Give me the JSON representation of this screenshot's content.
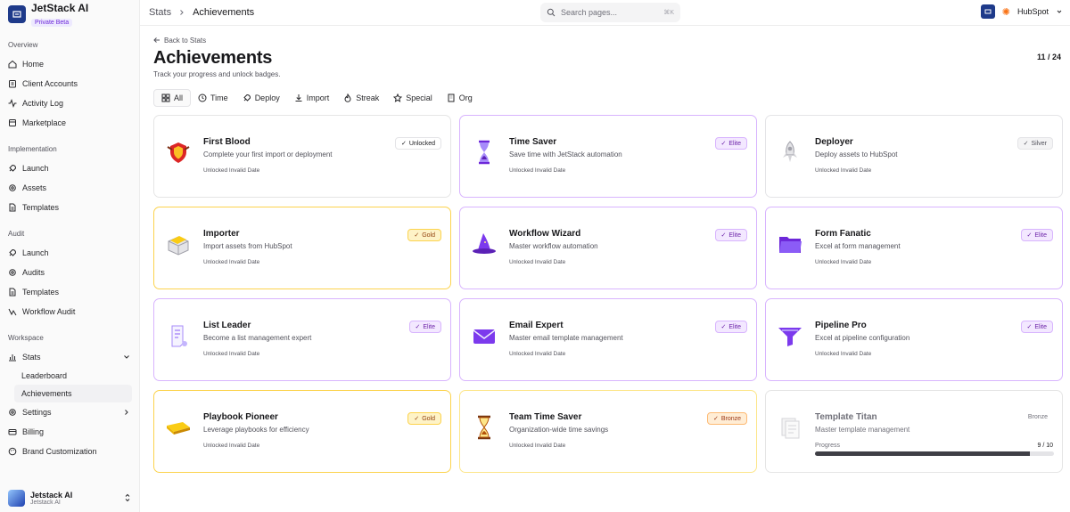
{
  "brand": {
    "name": "JetStack AI",
    "badge": "Private Beta"
  },
  "sidebar": {
    "overview_title": "Overview",
    "overview": [
      {
        "label": "Home",
        "icon": "home-icon"
      },
      {
        "label": "Client Accounts",
        "icon": "clipboard-icon"
      },
      {
        "label": "Activity Log",
        "icon": "activity-icon"
      },
      {
        "label": "Marketplace",
        "icon": "store-icon"
      }
    ],
    "implementation_title": "Implementation",
    "implementation": [
      {
        "label": "Launch",
        "icon": "rocket-icon"
      },
      {
        "label": "Assets",
        "icon": "gear-icon"
      },
      {
        "label": "Templates",
        "icon": "file-icon"
      }
    ],
    "audit_title": "Audit",
    "audit": [
      {
        "label": "Launch",
        "icon": "rocket-icon"
      },
      {
        "label": "Audits",
        "icon": "gear-icon"
      },
      {
        "label": "Templates",
        "icon": "file-icon"
      },
      {
        "label": "Workflow Audit",
        "icon": "workflow-icon"
      }
    ],
    "workspace_title": "Workspace",
    "stats_label": "Stats",
    "stats_sub": [
      "Leaderboard",
      "Achievements"
    ],
    "settings_label": "Settings",
    "billing_label": "Billing",
    "brand_label": "Brand Customization"
  },
  "user": {
    "name": "Jetstack AI",
    "org": "Jetstack AI"
  },
  "topbar": {
    "crumb_parent": "Stats",
    "crumb_current": "Achievements",
    "search_placeholder": "Search pages...",
    "search_shortcut": "⌘K",
    "portal": "HubSpot"
  },
  "page": {
    "back": "Back to Stats",
    "title": "Achievements",
    "subtitle": "Track your progress and unlock badges.",
    "counter": "11 / 24"
  },
  "tabs": [
    {
      "label": "All",
      "icon": "grid-icon"
    },
    {
      "label": "Time",
      "icon": "clock-icon"
    },
    {
      "label": "Deploy",
      "icon": "rocket-icon"
    },
    {
      "label": "Import",
      "icon": "download-icon"
    },
    {
      "label": "Streak",
      "icon": "flame-icon"
    },
    {
      "label": "Special",
      "icon": "star-icon"
    },
    {
      "label": "Org",
      "icon": "building-icon"
    }
  ],
  "achievements": [
    {
      "title": "First Blood",
      "desc": "Complete your first import or deployment",
      "date": "Unlocked Invalid Date",
      "badge": "Unlocked",
      "tier": "unlocked",
      "icon": "dragon-shield-icon"
    },
    {
      "title": "Time Saver",
      "desc": "Save time with JetStack automation",
      "date": "Unlocked Invalid Date",
      "badge": "Elite",
      "tier": "elite",
      "icon": "hourglass-icon"
    },
    {
      "title": "Deployer",
      "desc": "Deploy assets to HubSpot",
      "date": "Unlocked Invalid Date",
      "badge": "Silver",
      "tier": "silver",
      "icon": "rocket-icon"
    },
    {
      "title": "Importer",
      "desc": "Import assets from HubSpot",
      "date": "Unlocked Invalid Date",
      "badge": "Gold",
      "tier": "gold",
      "icon": "package-icon"
    },
    {
      "title": "Workflow Wizard",
      "desc": "Master workflow automation",
      "date": "Unlocked Invalid Date",
      "badge": "Elite",
      "tier": "elite",
      "icon": "wizard-hat-icon"
    },
    {
      "title": "Form Fanatic",
      "desc": "Excel at form management",
      "date": "Unlocked Invalid Date",
      "badge": "Elite",
      "tier": "elite",
      "icon": "folder-icon"
    },
    {
      "title": "List Leader",
      "desc": "Become a list management expert",
      "date": "Unlocked Invalid Date",
      "badge": "Elite",
      "tier": "elite",
      "icon": "scroll-icon"
    },
    {
      "title": "Email Expert",
      "desc": "Master email template management",
      "date": "Unlocked Invalid Date",
      "badge": "Elite",
      "tier": "elite",
      "icon": "envelope-icon"
    },
    {
      "title": "Pipeline Pro",
      "desc": "Excel at pipeline configuration",
      "date": "Unlocked Invalid Date",
      "badge": "Elite",
      "tier": "elite",
      "icon": "funnel-icon"
    },
    {
      "title": "Playbook Pioneer",
      "desc": "Leverage playbooks for efficiency",
      "date": "Unlocked Invalid Date",
      "badge": "Gold",
      "tier": "gold",
      "icon": "book-icon"
    },
    {
      "title": "Team Time Saver",
      "desc": "Organization-wide time savings",
      "date": "Unlocked Invalid Date",
      "badge": "Bronze",
      "tier": "bronze",
      "icon": "hourglass-icon"
    },
    {
      "title": "Template Titan",
      "desc": "Master template management",
      "badge": "Bronze",
      "tier": "bronze-locked",
      "icon": "templates-icon",
      "progress_label": "Progress",
      "progress_text": "9 / 10",
      "progress_fraction": 0.9
    }
  ],
  "colors": {
    "elite": "#d8b4fe",
    "gold": "#fcd34d",
    "bronze": "#fdba74",
    "brand": "#1e3a8a"
  }
}
